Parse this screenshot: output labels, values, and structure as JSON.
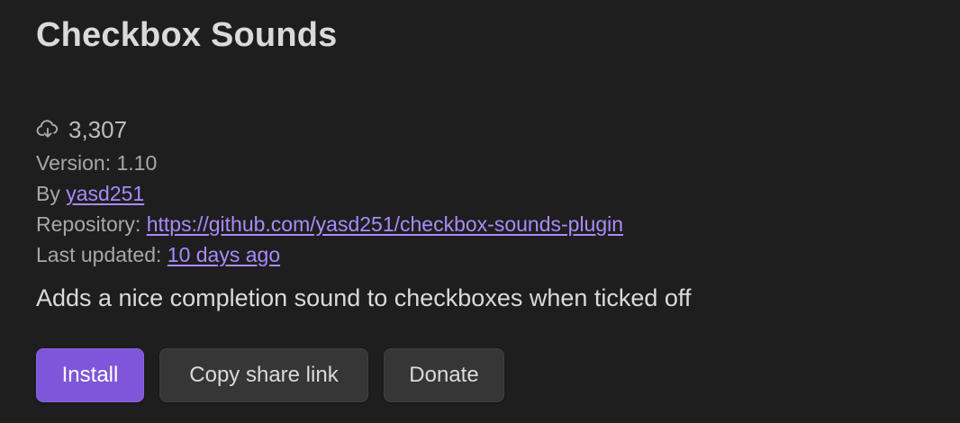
{
  "plugin": {
    "name": "Checkbox Sounds",
    "downloads": "3,307",
    "download_icon": "cloud-download-icon",
    "version_label": "Version:",
    "version": "1.10",
    "author_label": "By",
    "author": "yasd251",
    "repository_label": "Repository:",
    "repository_url": "https://github.com/yasd251/checkbox-sounds-plugin",
    "updated_label": "Last updated:",
    "updated": "10 days ago",
    "description": "Adds a nice completion sound to checkboxes when ticked off"
  },
  "actions": {
    "install_label": "Install",
    "share_label": "Copy share link",
    "donate_label": "Donate"
  },
  "colors": {
    "background": "#1e1e1e",
    "accent": "#7f56d9",
    "link": "#a88bfa"
  }
}
